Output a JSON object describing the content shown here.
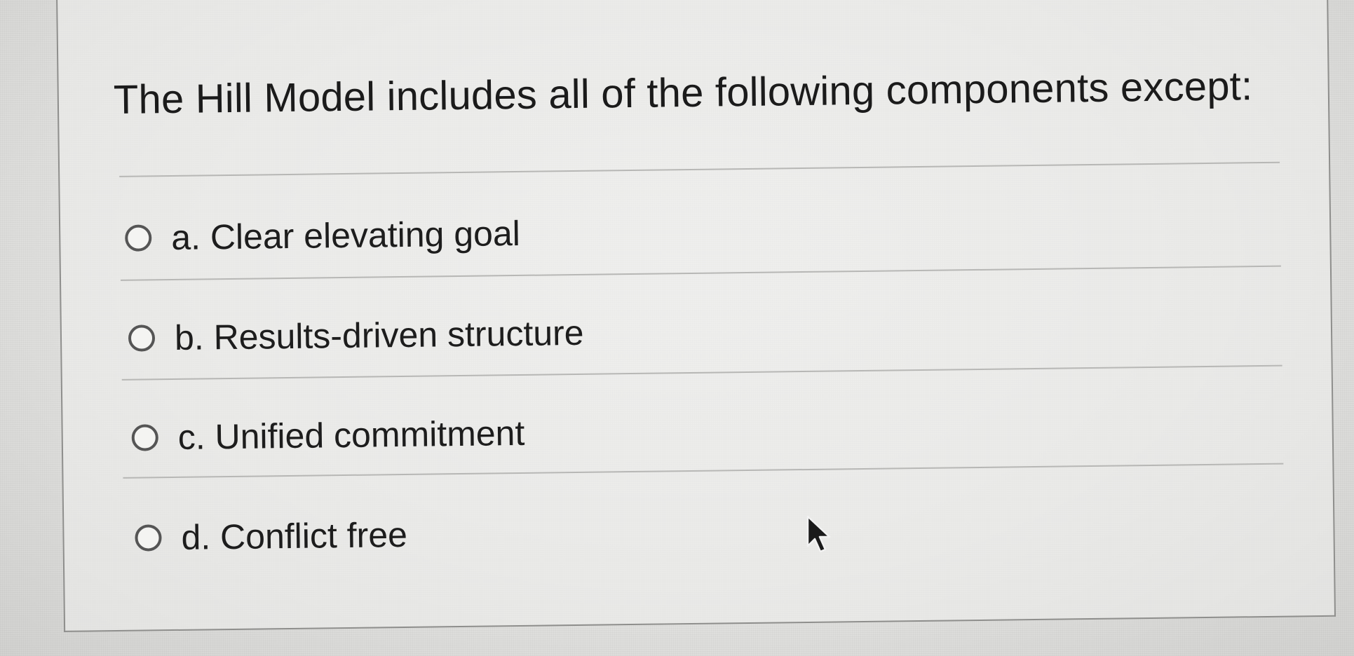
{
  "question": {
    "text": "The Hill Model includes all of the following components except:"
  },
  "options": [
    {
      "letter": "a.",
      "label": "a. Clear elevating goal",
      "selected": false
    },
    {
      "letter": "b.",
      "label": "b. Results-driven structure",
      "selected": false
    },
    {
      "letter": "c.",
      "label": "c. Unified commitment",
      "selected": false
    },
    {
      "letter": "d.",
      "label": "d. Conflict free",
      "selected": false
    }
  ],
  "icons": {
    "radio": "radio-button-icon",
    "cursor": "mouse-pointer-icon"
  },
  "colors": {
    "background": "#e3e3e1",
    "text": "#1b1b1b",
    "border": "#8e8e8c",
    "radio_border": "#555555"
  }
}
